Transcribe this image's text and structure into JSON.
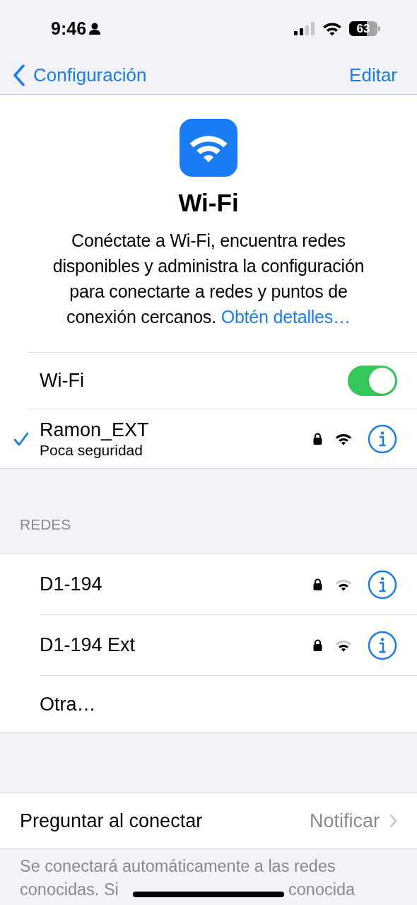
{
  "status_bar": {
    "time": "9:46",
    "battery": "63"
  },
  "nav": {
    "back": "Configuración",
    "action": "Editar"
  },
  "header": {
    "title": "Wi-Fi",
    "description": "Conéctate a Wi-Fi, encuentra redes disponibles y administra la configuración para conectarte a redes y puntos de conexión cercanos.",
    "link": "Obtén detalles…"
  },
  "wifi_toggle": {
    "label": "Wi-Fi",
    "on": true
  },
  "current_network": {
    "name": "Ramon_EXT",
    "subtitle": "Poca seguridad",
    "selected": true,
    "locked": true,
    "weak_signal": false
  },
  "networks_header": "REDES",
  "networks": [
    {
      "name": "D1-194",
      "locked": true,
      "weak_signal": true
    },
    {
      "name": "D1-194 Ext",
      "locked": true,
      "weak_signal": true
    },
    {
      "name": "Otra…",
      "kind": "other"
    }
  ],
  "ask_to_join": {
    "label": "Preguntar al conectar",
    "value": "Notificar"
  },
  "footer": {
    "line_1": "Se conectará automáticamente a las redes",
    "line_2_start": "conocidas. Si",
    "line_2_end": "conocida"
  }
}
